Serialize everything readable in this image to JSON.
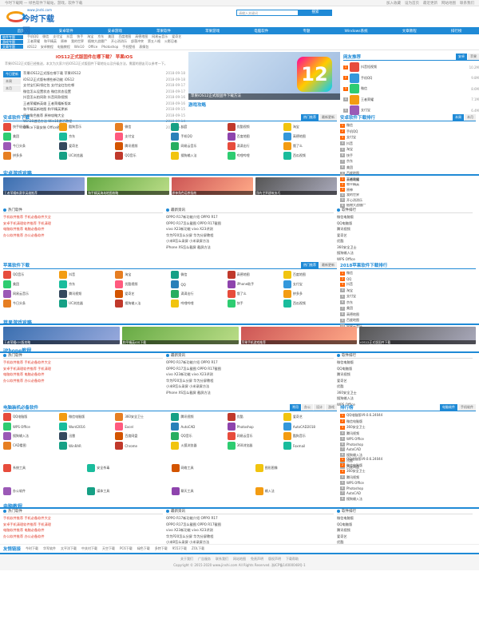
{
  "topbar": {
    "left": "今时下载网 — 绿色软件下载站，游戏，软件下载",
    "links": [
      "加入收藏",
      "设为首页",
      "最近更新",
      "网站地图",
      "联系我们"
    ]
  },
  "logo": {
    "text": "今时下载网",
    "sub": "www.jinshi.com"
  },
  "search": {
    "placeholder": "请输入关键词",
    "button": "搜索"
  },
  "nav": [
    "首页",
    "安卓软件",
    "安卓游戏",
    "苹果软件",
    "苹果游戏",
    "电脑软件",
    "专题",
    "Windows系统",
    "文章教程",
    "排行榜"
  ],
  "subnav": {
    "labels": [
      "软件专题",
      "游戏专题",
      "文章专题"
    ],
    "rows": [
      [
        "手机QQ",
        "微信",
        "支付宝",
        "抖音",
        "快手",
        "淘宝",
        "京东",
        "美团",
        "百度地图",
        "高德地图",
        "网易云音乐",
        "爱奇艺"
      ],
      [
        "王者荣耀",
        "和平精英",
        "原神",
        "我的世界",
        "植物大战僵尸",
        "开心消消乐",
        "部落冲突",
        "第五人格",
        "火影忍者"
      ],
      [
        "iOS12",
        "安卓教程",
        "电脑教程",
        "Win10",
        "Office",
        "Photoshop",
        "手机壁纸",
        "表情包"
      ]
    ]
  },
  "hero": {
    "title": "iOS12正式版固件在哪下载？ 苹果iOS",
    "desc": "苹果iOS12正式版已经推送，本文为大家介绍iOS12正式版固件下载地址以及升级方法，需要的朋友可以参考一下。",
    "banner_num": "12",
    "banner_caption": "苹果iOS12正式版固件下载方法"
  },
  "left_list": {
    "tabs": [
      "今日更新",
      "本周",
      "本月"
    ],
    "items": [
      {
        "t": "苹果iOS12正式版在哪下载 苹果iOS12",
        "d": "2018-09-18"
      },
      {
        "t": "iOS12正式版有哪些新功能 iOS12",
        "d": "2018-09-18"
      },
      {
        "t": "支付宝扫码领红包 支付宝红包在哪",
        "d": "2018-09-17"
      },
      {
        "t": "微信怎么设置状态 微信状态设置",
        "d": "2018-09-17"
      },
      {
        "t": "抖音怎么拍同款 抖音同款视频",
        "d": "2018-09-16"
      },
      {
        "t": "王者荣耀新英雄 王者荣耀新版本",
        "d": "2018-09-16"
      },
      {
        "t": "和平精英新地图 和平精英更新",
        "d": "2018-09-15"
      },
      {
        "t": "原神角色推荐 原神攻略大全",
        "d": "2018-09-15"
      },
      {
        "t": "Win10激活方法 Win10激活教程",
        "d": "2018-09-14"
      },
      {
        "t": "Office下载安装 Office教程",
        "d": "2018-09-14"
      }
    ]
  },
  "game_news": {
    "title": "游戏攻略",
    "items": [
      "王者荣耀新英雄技能介绍 王者荣耀攻略",
      "和平精英新版本更新内容 和平精英攻略",
      "原神新角色强度分析 原神攻略大全",
      "我的世界建筑教程 我的世界攻略"
    ]
  },
  "hot_rank": {
    "title": "网友推荐",
    "tabs": [
      "安卓",
      "苹果"
    ],
    "items": [
      {
        "n": "抖音短视频",
        "d": "10.2M"
      },
      {
        "n": "手机QQ",
        "d": "9.8M"
      },
      {
        "n": "微信",
        "d": "8.6M"
      },
      {
        "n": "王者荣耀",
        "d": "7.1M"
      },
      {
        "n": "支付宝",
        "d": "6.4M"
      }
    ]
  },
  "android_apps": {
    "title": "安卓软件下载",
    "tabs": [
      "热门推荐",
      "最新更新"
    ],
    "apps": [
      "快手极速版",
      "酷狗音乐",
      "微信",
      "抖音",
      "优酷视频",
      "淘宝",
      "美团",
      "京东",
      "支付宝",
      "手机QQ",
      "百度地图",
      "高德地图",
      "今日头条",
      "爱奇艺",
      "腾讯视频",
      "网易云音乐",
      "滴滴出行",
      "饿了么",
      "拼多多",
      "UC浏览器",
      "QQ音乐",
      "搜狗输入法",
      "哔哩哔哩",
      "西瓜视频"
    ]
  },
  "android_rank": {
    "title": "安卓软件下载排行",
    "tabs": [
      "本周",
      "本月"
    ],
    "items": [
      "微信",
      "手机QQ",
      "支付宝",
      "抖音",
      "淘宝",
      "快手",
      "京东",
      "美团",
      "百度地图",
      "高德地图"
    ]
  },
  "android_games": {
    "title": "安卓游戏攻略",
    "thumbs": [
      "王者荣耀新赛季英雄推荐",
      "和平精英海岛地图攻略",
      "原神角色培养指南",
      "我的世界建筑技巧"
    ]
  },
  "android_games_rank": {
    "items": [
      "王者荣耀",
      "和平精英",
      "原神",
      "我的世界",
      "开心消消乐",
      "植物大战僵尸"
    ]
  },
  "news_blocks": [
    {
      "head": "热门软件",
      "img": "今时下载",
      "items": [
        "手机软件推荐 手机必备软件大全",
        "安卓手机清理软件推荐 手机清理",
        "电脑软件推荐 电脑必备软件",
        "办公软件推荐 办公必备软件"
      ]
    },
    {
      "head": "最新资讯",
      "items": [
        "OPPO R17新功能介绍 OPPO R17",
        "OPPO R17怎么截图 OPPO R17截图",
        "vivo X23新功能 vivo X23评测",
        "华为P20怎么分屏 华为分屏教程",
        "小米8怎么录屏 小米录屏方法",
        "iPhone XS怎么截屏 截屏方法"
      ]
    },
    {
      "head": "软件排行",
      "items": [
        "微信电脑版",
        "QQ电脑版",
        "腾讯视频",
        "爱奇艺",
        "优酷",
        "360安全卫士",
        "搜狗输入法",
        "WPS Office"
      ]
    }
  ],
  "ios_apps": {
    "title": "苹果软件下载",
    "tabs": [
      "热门推荐",
      "最新更新"
    ],
    "apps": [
      "QQ音乐",
      "抖音",
      "淘宝",
      "微信",
      "高德地图",
      "百度地图",
      "美团",
      "京东",
      "优酷视频",
      "QQ",
      "iPhone助手",
      "支付宝",
      "网易云音乐",
      "腾讯视频",
      "爱奇艺",
      "滴滴出行",
      "饿了么",
      "拼多多",
      "今日头条",
      "UC浏览器",
      "搜狗输入法",
      "哔哩哔哩",
      "快手",
      "西瓜视频"
    ]
  },
  "ios_rank": {
    "title": "2018苹果软件下载排行",
    "items": [
      "微信",
      "QQ",
      "抖音",
      "淘宝",
      "支付宝",
      "京东",
      "美团",
      "高德地图",
      "百度地图",
      "网易云音乐"
    ]
  },
  "ios_games": {
    "title": "苹果游戏攻略",
    "thumbs": [
      "王者荣耀iOS版攻略",
      "和平精英iOS下载",
      "苹果手机游戏推荐",
      "iOS12正式版固件下载"
    ]
  },
  "iphone": {
    "title": "iPhone教程"
  },
  "pc_apps": {
    "title": "电脑装机必备软件",
    "tabs": [
      "常用",
      "办公",
      "设计",
      "游戏"
    ],
    "apps": [
      "QQ电脑版",
      "微信电脑版",
      "360安全卫士",
      "腾讯视频",
      "优酷",
      "爱奇艺",
      "WPS Office",
      "Word2016",
      "Excel",
      "AutoCAD",
      "Photoshop",
      "AutoCAD2018",
      "搜狗输入法",
      "迅雷",
      "百度网盘",
      "QQ音乐",
      "网易云音乐",
      "酷狗音乐",
      "CAD看图",
      "WinRAR",
      "Chrome",
      "火狐浏览器",
      "360浏览器",
      "Foxmail"
    ]
  },
  "pc_rank": {
    "title": "排行榜",
    "tabs": [
      "电脑软件",
      "手机软件"
    ],
    "items": [
      "QQ电脑版V9.0.6.24044",
      "微信电脑版",
      "360安全卫士",
      "腾讯视频",
      "WPS Office",
      "Photoshop",
      "AutoCAD",
      "搜狗输入法",
      "迅雷",
      "百度网盘"
    ]
  },
  "pc_cat": {
    "cats": [
      "系统工具",
      "安全杀毒",
      "网络工具",
      "图形图像",
      "办公软件",
      "媒体工具",
      "聊天工具",
      "输入法"
    ]
  },
  "pc_tut": {
    "title": "电脑教程"
  },
  "friends": {
    "title": "友情链接",
    "links": [
      "今时下载",
      "华军软件",
      "太平洋下载",
      "中关村下载",
      "天空下载",
      "PC6下载",
      "绿色下载",
      "多特下载",
      "9553下载",
      "ZOL下载"
    ]
  },
  "footer": {
    "links": [
      "关于我们",
      "广告服务",
      "联系我们",
      "网站地图",
      "免责声明",
      "版权声明",
      "下载帮助"
    ],
    "copy": "Copyright © 2015-2020 www.jinshi.com All Rights Reserved. 浙ICP备14000048号-1"
  }
}
